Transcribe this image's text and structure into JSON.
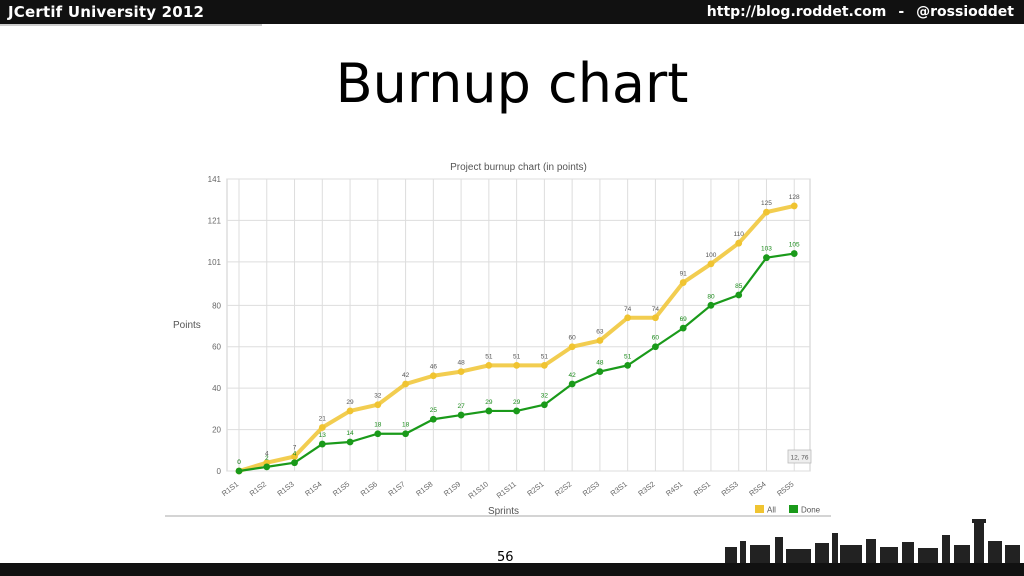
{
  "header": {
    "left_text": "JCertif University 2012",
    "right_url": "http://blog.roddet.com",
    "separator": "-",
    "right_handle": "@rossioddet"
  },
  "slide": {
    "title": "Burnup chart",
    "page_number": "56"
  },
  "colors": {
    "all": "#f0c431",
    "done": "#1a9a1a",
    "grid": "#dddddd",
    "topbar": "#111111"
  },
  "chart_data": {
    "type": "line",
    "title": "Project burnup chart (in points)",
    "xlabel": "Sprints",
    "ylabel": "Points",
    "ylim": [
      0,
      141
    ],
    "yticks": [
      "0",
      "20",
      "40",
      "60",
      "80",
      "101",
      "121",
      "141"
    ],
    "categories": [
      "R1S1",
      "R1S2",
      "R1S3",
      "R1S4",
      "R1S5",
      "R1S6",
      "R1S7",
      "R1S8",
      "R1S9",
      "R1S10",
      "R1S11",
      "R2S1",
      "R2S2",
      "R2S3",
      "R3S1",
      "R3S2",
      "R4S1",
      "R5S1",
      "R5S3",
      "R5S4",
      "R5S5"
    ],
    "series": [
      {
        "name": "All",
        "color": "#f0c431",
        "values": [
          0,
          4,
          7,
          21,
          29,
          32,
          42,
          46,
          48,
          51,
          51,
          51,
          60,
          63,
          74,
          74,
          91,
          100,
          110,
          125,
          128
        ]
      },
      {
        "name": "Done",
        "color": "#1a9a1a",
        "values": [
          0,
          2,
          4,
          13,
          14,
          18,
          18,
          25,
          27,
          29,
          29,
          32,
          42,
          48,
          51,
          60,
          69,
          80,
          85,
          103,
          105
        ]
      }
    ],
    "legend_position": "bottom-right",
    "tooltip_text": "12, 76",
    "grid": true
  }
}
